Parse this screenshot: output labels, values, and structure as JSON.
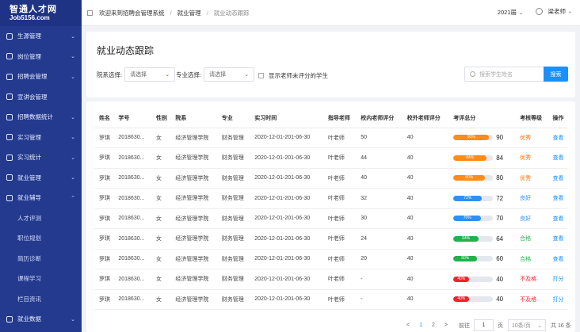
{
  "sidebar": {
    "logo_line1": "智通人才网",
    "logo_line2": "Job5156.com",
    "items": [
      {
        "label": "生源管理",
        "arrow": "⌄"
      },
      {
        "label": "岗位管理",
        "arrow": "⌄"
      },
      {
        "label": "招聘会管理",
        "arrow": "⌄"
      },
      {
        "label": "宣讲会管理",
        "arrow": ""
      },
      {
        "label": "招聘数据统计",
        "arrow": "⌄"
      },
      {
        "label": "实习管理",
        "arrow": "⌄"
      },
      {
        "label": "实习统计",
        "arrow": "⌄"
      },
      {
        "label": "就业管理",
        "arrow": "⌄"
      },
      {
        "label": "就业辅导",
        "arrow": "⌃"
      }
    ],
    "subitems": [
      "人才评测",
      "职位规划",
      "简历诊断",
      "课程学习",
      "栏目资讯"
    ],
    "last_item": {
      "label": "就业数据",
      "arrow": "⌄"
    }
  },
  "topbar": {
    "crumb1": "欢迎来到招聘会管理系统",
    "sep": "/",
    "crumb2": "就业管理",
    "crumb3": "就业动态跟踪",
    "year": "2021届",
    "year_caret": "⌄",
    "user": "梁老师",
    "user_caret": "⌄"
  },
  "filters": {
    "title": "就业动态跟踪",
    "dept_label": "院系选择:",
    "dept_placeholder": "请选择",
    "major_label": "专业选择:",
    "major_placeholder": "请选择",
    "checkbox_label": "显示老师未评分的学生",
    "search_placeholder": "搜索学生姓名",
    "search_button": "搜索"
  },
  "table": {
    "headers": [
      "姓名",
      "学号",
      "性别",
      "院系",
      "专业",
      "实习时间",
      "指导老师",
      "校内老师评分",
      "校外老师评分",
      "考评总分",
      "考核等级",
      "操作"
    ],
    "rows": [
      {
        "name": "罗琪",
        "id": "2018630...",
        "sex": "女",
        "dept": "经济管理学院",
        "major": "财务管理",
        "time": "2020-12-01-201-06-30",
        "teacher": "叶老师",
        "inner": "50",
        "outer": "40",
        "pct": "90%",
        "score": "90",
        "ratio": 0.9,
        "color": "#ff8c1a",
        "grade": "优秀",
        "gcolor": "#ff6a00",
        "op": "查看"
      },
      {
        "name": "罗琪",
        "id": "2018630...",
        "sex": "女",
        "dept": "经济管理学院",
        "major": "财务管理",
        "time": "2020-12-01-201-06-30",
        "teacher": "叶老师",
        "inner": "44",
        "outer": "40",
        "pct": "84%",
        "score": "84",
        "ratio": 0.84,
        "color": "#ff8c1a",
        "grade": "优秀",
        "gcolor": "#ff6a00",
        "op": "查看"
      },
      {
        "name": "罗琪",
        "id": "2018630...",
        "sex": "女",
        "dept": "经济管理学院",
        "major": "财务管理",
        "time": "2020-12-01-201-06-30",
        "teacher": "叶老师",
        "inner": "40",
        "outer": "40",
        "pct": "80%",
        "score": "80",
        "ratio": 0.8,
        "color": "#ff8c1a",
        "grade": "优秀",
        "gcolor": "#ff6a00",
        "op": "查看"
      },
      {
        "name": "罗琪",
        "id": "2018630...",
        "sex": "女",
        "dept": "经济管理学院",
        "major": "财务管理",
        "time": "2020-12-01-201-06-30",
        "teacher": "叶老师",
        "inner": "32",
        "outer": "40",
        "pct": "72%",
        "score": "72",
        "ratio": 0.72,
        "color": "#2f8ff3",
        "grade": "良好",
        "gcolor": "#2f8ff3",
        "op": "查看"
      },
      {
        "name": "罗琪",
        "id": "2018630...",
        "sex": "女",
        "dept": "经济管理学院",
        "major": "财务管理",
        "time": "2020-12-01-201-06-30",
        "teacher": "叶老师",
        "inner": "30",
        "outer": "40",
        "pct": "70%",
        "score": "70",
        "ratio": 0.7,
        "color": "#2f8ff3",
        "grade": "良好",
        "gcolor": "#2f8ff3",
        "op": "查看"
      },
      {
        "name": "罗琪",
        "id": "2018630...",
        "sex": "女",
        "dept": "经济管理学院",
        "major": "财务管理",
        "time": "2020-12-01-201-06-30",
        "teacher": "叶老师",
        "inner": "24",
        "outer": "40",
        "pct": "64%",
        "score": "64",
        "ratio": 0.64,
        "color": "#22b14c",
        "grade": "合格",
        "gcolor": "#22b14c",
        "op": "查看"
      },
      {
        "name": "罗琪",
        "id": "2018630...",
        "sex": "女",
        "dept": "经济管理学院",
        "major": "财务管理",
        "time": "2020-12-01-201-06-30",
        "teacher": "叶老师",
        "inner": "20",
        "outer": "40",
        "pct": "60%",
        "score": "60",
        "ratio": 0.6,
        "color": "#22b14c",
        "grade": "合格",
        "gcolor": "#22b14c",
        "op": "查看"
      },
      {
        "name": "罗琪",
        "id": "2018630...",
        "sex": "女",
        "dept": "经济管理学院",
        "major": "财务管理",
        "time": "2020-12-01-201-06-30",
        "teacher": "叶老师",
        "inner": "-",
        "outer": "40",
        "pct": "40%",
        "score": "40",
        "ratio": 0.4,
        "color": "#f5222d",
        "grade": "不及格",
        "gcolor": "#f5222d",
        "op": "打分"
      },
      {
        "name": "罗琪",
        "id": "2018630...",
        "sex": "女",
        "dept": "经济管理学院",
        "major": "财务管理",
        "time": "2020-12-01-201-06-30",
        "teacher": "叶老师",
        "inner": "-",
        "outer": "40",
        "pct": "40%",
        "score": "40",
        "ratio": 0.4,
        "color": "#f5222d",
        "grade": "不及格",
        "gcolor": "#f5222d",
        "op": "打分"
      }
    ]
  },
  "pager": {
    "prev": "<",
    "p1": "1",
    "p2": "2",
    "next": ">",
    "goto": "前往",
    "page_value": "1",
    "page_unit": "页",
    "size": "10条/页",
    "size_caret": "⌄",
    "total": "共 16 条"
  }
}
